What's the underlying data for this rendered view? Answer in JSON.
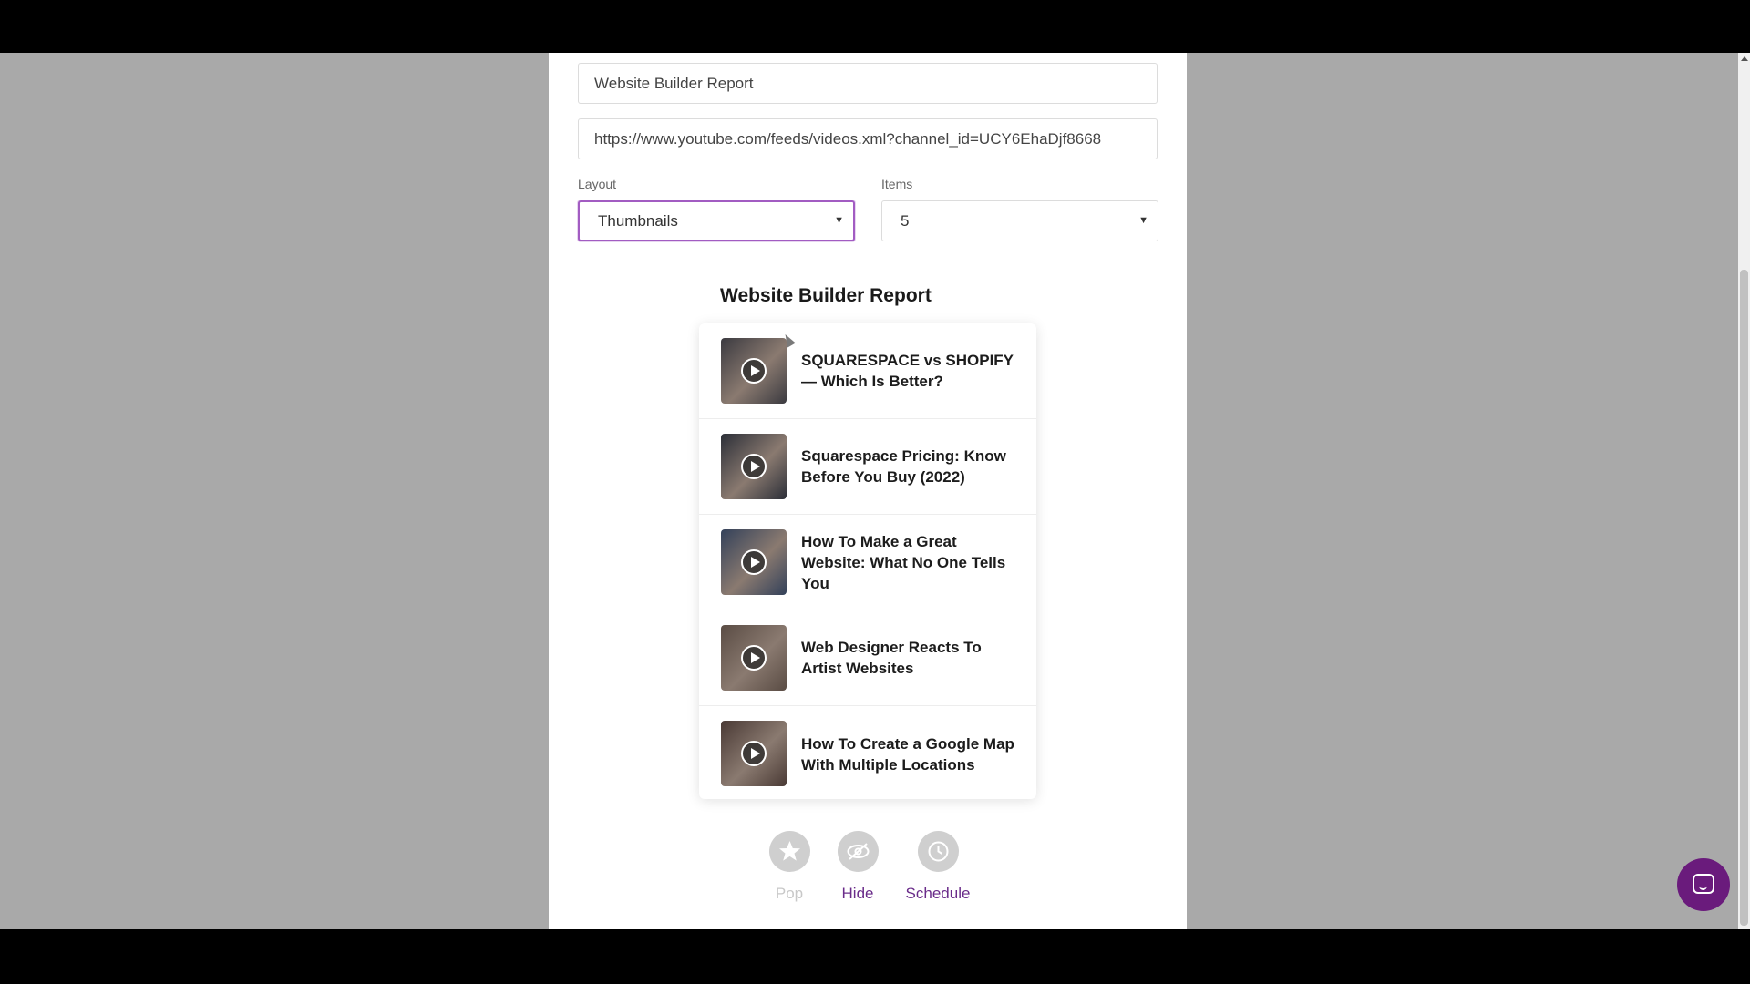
{
  "form": {
    "title_value": "Website Builder Report",
    "url_value": "https://www.youtube.com/feeds/videos.xml?channel_id=UCY6EhaDjf8668",
    "layout_label": "Layout",
    "layout_value": "Thumbnails",
    "items_label": "Items",
    "items_value": "5"
  },
  "feed": {
    "title": "Website Builder Report",
    "items": [
      {
        "title": "SQUARESPACE vs SHOPIFY — Which Is Better?",
        "thumb_color": "#3b3a40"
      },
      {
        "title": "Squarespace Pricing: Know Before You Buy (2022)",
        "thumb_color": "#2c2f38"
      },
      {
        "title": "How To Make a Great Website: What No One Tells You",
        "thumb_color": "#33415a"
      },
      {
        "title": "Web Designer Reacts To Artist Websites",
        "thumb_color": "#5a4c44"
      },
      {
        "title": "How To Create a Google Map With Multiple Locations",
        "thumb_color": "#4a3a35"
      }
    ]
  },
  "actions": {
    "pop": "Pop",
    "hide": "Hide",
    "schedule": "Schedule"
  },
  "colors": {
    "accent": "#6a2c8a",
    "focus_border": "#a25cc2",
    "page_background": "#a9a9a9"
  },
  "icons": [
    "star-icon",
    "eye-slash-icon",
    "clock-icon",
    "play-icon",
    "chat-icon",
    "chevron-down-icon"
  ]
}
